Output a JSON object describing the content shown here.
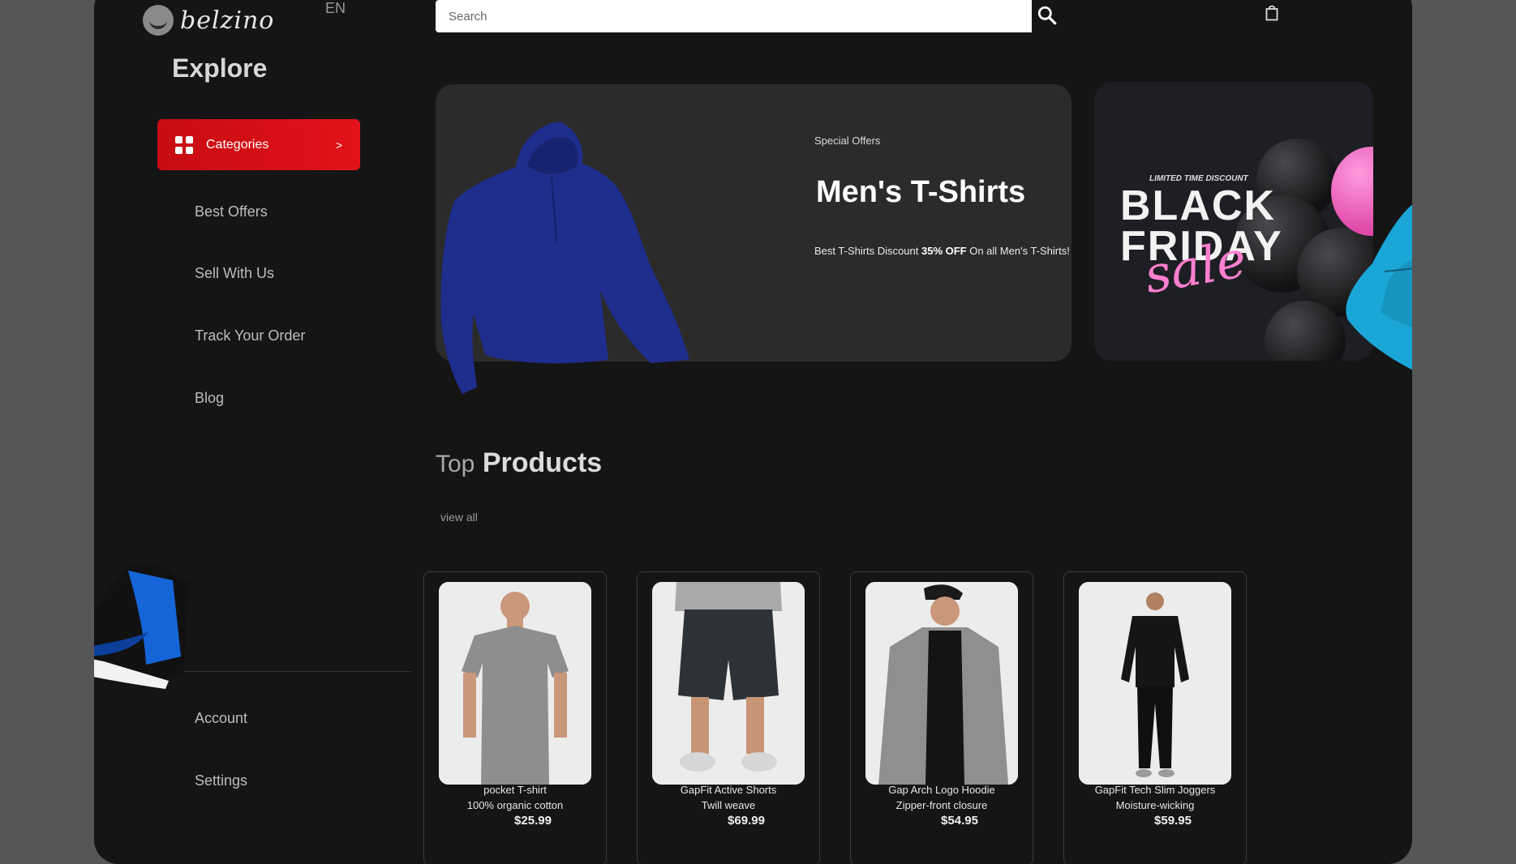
{
  "brand": {
    "name": "belzino",
    "lang": "EN"
  },
  "sidebar": {
    "title": "Explore",
    "categories_label": "Categories",
    "categories_chevron": ">",
    "items": [
      {
        "label": "Best Offers"
      },
      {
        "label": "Sell With Us"
      },
      {
        "label": "Track Your Order"
      },
      {
        "label": "Blog"
      }
    ],
    "bottom_items": [
      {
        "label": "Account"
      },
      {
        "label": "Settings"
      }
    ]
  },
  "header": {
    "search_placeholder": "Search"
  },
  "hero": {
    "eyebrow": "Special Offers",
    "title": "Men's T-Shirts",
    "desc_prefix": "Best T-Shirts Discount ",
    "desc_highlight": "35% OFF",
    "desc_suffix": " On all Men's T-Shirts!"
  },
  "promo": {
    "small": "LIMITED TIME DISCOUNT",
    "line1": "BLACK",
    "line2": "FRIDAY",
    "script": "sale"
  },
  "products_section": {
    "title_light": "Top",
    "title_bold": "Products",
    "view_all": "view all"
  },
  "products": [
    {
      "name": "pocket T-shirt",
      "desc": "100% organic cotton",
      "price": "$25.99"
    },
    {
      "name": "GapFit Active Shorts",
      "desc": "Twill weave",
      "price": "$69.99"
    },
    {
      "name": "Gap Arch Logo Hoodie",
      "desc": "Zipper-front closure",
      "price": "$54.95"
    },
    {
      "name": "GapFit Tech Slim Joggers",
      "desc": "Moisture-wicking",
      "price": "$59.95"
    }
  ],
  "colors": {
    "accent": "#e2121a",
    "background": "#151516",
    "card": "#2b2b2c"
  }
}
